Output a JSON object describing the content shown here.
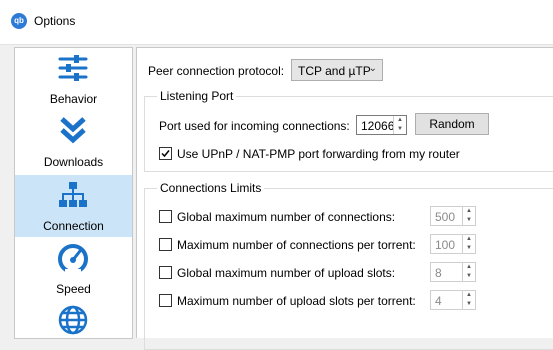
{
  "window": {
    "title": "Options",
    "app_icon_text": "qb"
  },
  "sidebar": {
    "items": [
      {
        "label": "Behavior",
        "icon": "sliders-icon"
      },
      {
        "label": "Downloads",
        "icon": "double-chevron-down-icon"
      },
      {
        "label": "Connection",
        "icon": "network-icon",
        "selected": true
      },
      {
        "label": "Speed",
        "icon": "speedometer-icon"
      },
      {
        "label": "",
        "icon": "globe-icon"
      }
    ]
  },
  "connection": {
    "protocol_label": "Peer connection protocol:",
    "protocol_value": "TCP and µTP",
    "listening": {
      "title": "Listening Port",
      "port_label": "Port used for incoming connections:",
      "port_value": "12066",
      "random_button": "Random",
      "upnp_label": "Use UPnP / NAT-PMP port forwarding from my router",
      "upnp_checked": true
    },
    "limits": {
      "title": "Connections Limits",
      "rows": [
        {
          "label": "Global maximum number of connections:",
          "value": "500",
          "checked": false
        },
        {
          "label": "Maximum number of connections per torrent:",
          "value": "100",
          "checked": false
        },
        {
          "label": "Global maximum number of upload slots:",
          "value": "8",
          "checked": false
        },
        {
          "label": "Maximum number of upload slots per torrent:",
          "value": "4",
          "checked": false
        }
      ]
    }
  },
  "colors": {
    "accent": "#1a73c8",
    "selected_bg": "#cce4f7"
  }
}
